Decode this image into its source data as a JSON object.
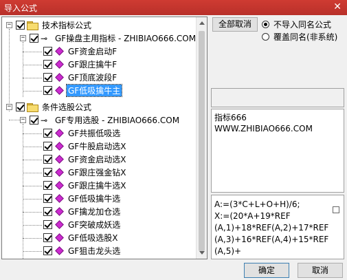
{
  "window": {
    "title": "导入公式",
    "close_glyph": "✕"
  },
  "tree": {
    "groups": [
      {
        "label": "技术指标公式",
        "children": [
          {
            "label": "GF操盘主用指标 - ZHIBIAO666.COM",
            "items": [
              "GF资金启动F",
              "GF跟庄擒牛F",
              "GF顶底波段F",
              "GF低吸擒牛主"
            ]
          }
        ]
      },
      {
        "label": "条件选股公式",
        "children": [
          {
            "label": "GF专用选股 - ZHIBIAO666.COM",
            "items": [
              "GF共振低吸选",
              "GF牛股启动选X",
              "GF资金启动选X",
              "GF跟庄强金钻X",
              "GF跟庄擒牛选X",
              "GF低吸擒牛选",
              "GF擒龙加仓选",
              "GF突破成妖选",
              "GF低吸选股X",
              "GF狙击龙头选"
            ]
          }
        ]
      }
    ],
    "selected_item": "GF低吸擒牛主"
  },
  "options": {
    "select_all_label": "全部取消",
    "radio_no_import": "不导入同名公式",
    "radio_overwrite": "覆盖同名(非系统)",
    "selected_radio": "no_import"
  },
  "info": {
    "line1": "指标666",
    "line2": "WWW.ZHIBIAO666.COM"
  },
  "formula": {
    "lines": [
      "A:=(3*C+L+O+H)/6;",
      "X:=(20*A+19*REF",
      "(A,1)+18*REF(A,2)+17*REF",
      "(A,3)+16*REF(A,4)+15*REF",
      "(A,5)+"
    ]
  },
  "buttons": {
    "ok": "确定",
    "cancel": "取消"
  }
}
